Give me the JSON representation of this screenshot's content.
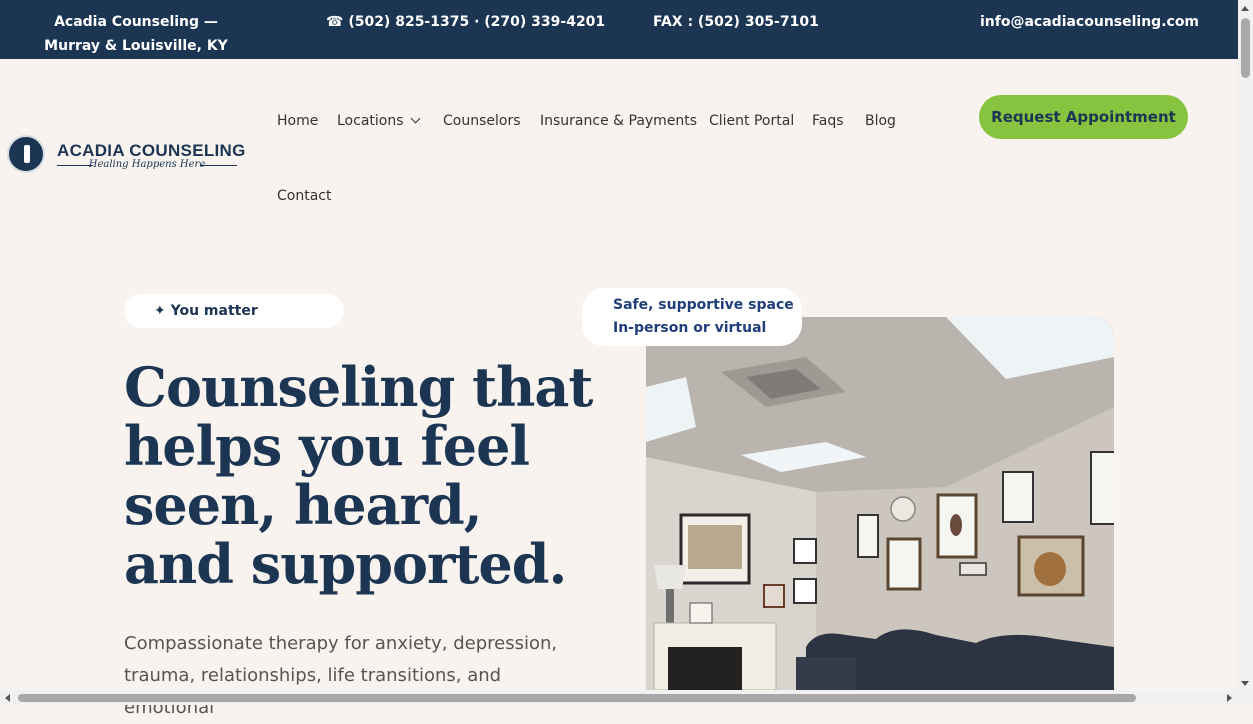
{
  "topbar": {
    "brand": "Acadia Counseling",
    "brand_rest": " — Murray & Louisville, KY",
    "phone_icon": "phone-icon",
    "phone": "☎ (502) 825-1375 · (270) 339-4201",
    "fax": "FAX : (502) 305-7101",
    "email": "info@acadiacounseling.com"
  },
  "logo": {
    "name": "ACADIA COUNSELING",
    "tagline": "Healing Happens Here"
  },
  "nav": {
    "home": "Home",
    "locations": "Locations",
    "counselors": "Counselors",
    "insurance": "Insurance & Payments",
    "portal": "Client Portal",
    "faqs": "Faqs",
    "blog": "Blog",
    "contact": "Contact"
  },
  "cta": {
    "label": "Request Appointment"
  },
  "hero": {
    "pill": "✦ You matter",
    "title": "Counseling that helps you feel seen, heard, and supported.",
    "description": "Compassionate therapy for anxiety, depression, trauma, relationships, life transitions, and emotional",
    "callout_line1": "Safe, supportive space",
    "callout_line2": "In-person or virtual"
  },
  "colors": {
    "topbar_bg": "#1b3553",
    "page_bg": "#f8f3ee",
    "accent_green": "#86c440",
    "heading_navy": "#1b3553"
  }
}
